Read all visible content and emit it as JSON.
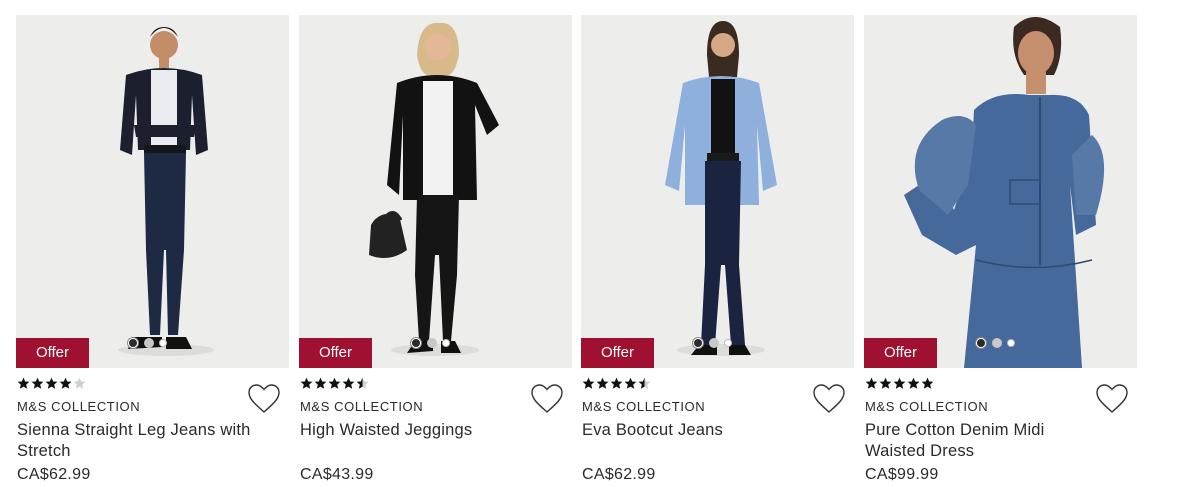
{
  "products": [
    {
      "badge": "Offer",
      "rating": 4,
      "brand": "M&S COLLECTION",
      "name": "Sienna Straight Leg Jeans with Stretch",
      "price": "CA$62.99",
      "image_dots": 3,
      "active_dot": 0
    },
    {
      "badge": "Offer",
      "rating": 4.5,
      "brand": "M&S COLLECTION",
      "name": "High Waisted Jeggings",
      "price": "CA$43.99",
      "image_dots": 3,
      "active_dot": 0
    },
    {
      "badge": "Offer",
      "rating": 4.5,
      "brand": "M&S COLLECTION",
      "name": "Eva Bootcut Jeans",
      "price": "CA$62.99",
      "image_dots": 3,
      "active_dot": 0
    },
    {
      "badge": "Offer",
      "rating": 5,
      "brand": "M&S COLLECTION",
      "name": "Pure Cotton Denim Midi Waisted Dress",
      "price": "CA$99.99",
      "image_dots": 3,
      "active_dot": 0
    }
  ],
  "colors": {
    "badge": "#a01030",
    "text": "#2a2a2a",
    "image_bg": "#ededeb"
  },
  "icons": {
    "wishlist": "heart-outline-icon",
    "rating": "star-icon"
  }
}
